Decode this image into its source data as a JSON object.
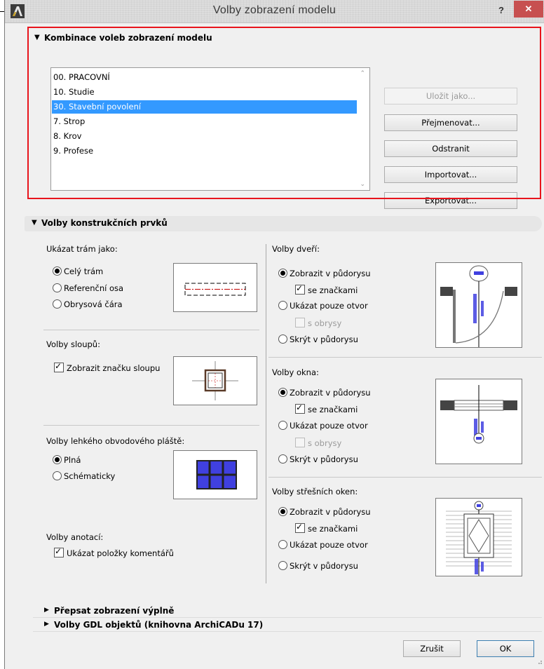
{
  "window": {
    "title": "Volby zobrazení modelu",
    "help": "?",
    "close": "✕"
  },
  "combos": {
    "header": "Kombinace voleb zobrazení modelu",
    "items": [
      {
        "label": "00. PRACOVNÍ",
        "selected": false
      },
      {
        "label": "10. Studie",
        "selected": false
      },
      {
        "label": "30. Stavební povolení",
        "selected": true
      },
      {
        "label": "7. Strop",
        "selected": false
      },
      {
        "label": "8. Krov",
        "selected": false
      },
      {
        "label": "9. Profese",
        "selected": false
      }
    ],
    "buttons": {
      "save_as": "Uložit jako...",
      "rename": "Přejmenovat...",
      "delete": "Odstranit",
      "import": "Importovat...",
      "export": "Exportovat..."
    }
  },
  "construction": {
    "header": "Volby konstrukčních prvků",
    "beam": {
      "title": "Ukázat trám jako:",
      "options": [
        "Celý trám",
        "Referenční osa",
        "Obrysová čára"
      ],
      "selected": 0
    },
    "column": {
      "title": "Volby sloupů:",
      "show_symbol": "Zobrazit značku sloupu",
      "checked": true
    },
    "curtain_wall": {
      "title": "Volby lehkého obvodového pláště:",
      "options": [
        "Plná",
        "Schématicky"
      ],
      "selected": 0
    },
    "annotation": {
      "title": "Volby anotací:",
      "show_comments": "Ukázat položky komentářů",
      "checked": true
    },
    "door": {
      "title": "Volby dveří:",
      "show_in_plan": "Zobrazit v půdorysu",
      "with_markers": "se značkami",
      "opening_only": "Ukázat pouze otvor",
      "with_outlines": "s obrysy",
      "hide_in_plan": "Skrýt v půdorysu"
    },
    "window": {
      "title": "Volby okna:",
      "show_in_plan": "Zobrazit v půdorysu",
      "with_markers": "se značkami",
      "opening_only": "Ukázat pouze otvor",
      "with_outlines": "s obrysy",
      "hide_in_plan": "Skrýt v půdorysu"
    },
    "skylight": {
      "title": "Volby střešních oken:",
      "show_in_plan": "Zobrazit v půdorysu",
      "with_markers": "se značkami",
      "opening_only": "Ukázat pouze otvor",
      "hide_in_plan": "Skrýt v půdorysu"
    }
  },
  "override": {
    "header": "Přepsat zobrazení výplně"
  },
  "gdl": {
    "header": "Volby GDL objektů (knihovna ArchiCADu 17)"
  },
  "footer": {
    "cancel": "Zrušit",
    "ok": "OK"
  },
  "colors": {
    "accent_selection": "#3399ff",
    "highlight_frame": "#e8141c",
    "close_button": "#c75050",
    "preview_blue": "#4040e0"
  }
}
